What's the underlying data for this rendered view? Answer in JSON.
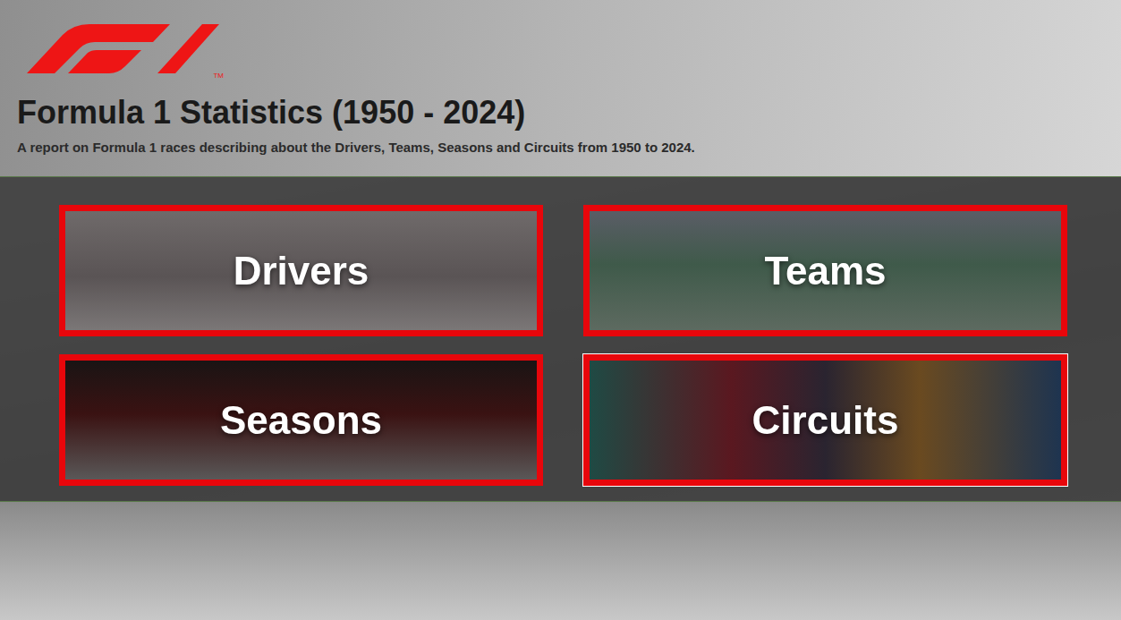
{
  "logo": {
    "trademark": "TM"
  },
  "header": {
    "title": "Formula 1 Statistics (1950 - 2024)",
    "subtitle": "A report on Formula 1 races describing about the Drivers, Teams, Seasons and Circuits from 1950 to 2024."
  },
  "cards": [
    {
      "label": "Drivers",
      "selected": false
    },
    {
      "label": "Teams",
      "selected": false
    },
    {
      "label": "Seasons",
      "selected": false
    },
    {
      "label": "Circuits",
      "selected": true
    }
  ]
}
